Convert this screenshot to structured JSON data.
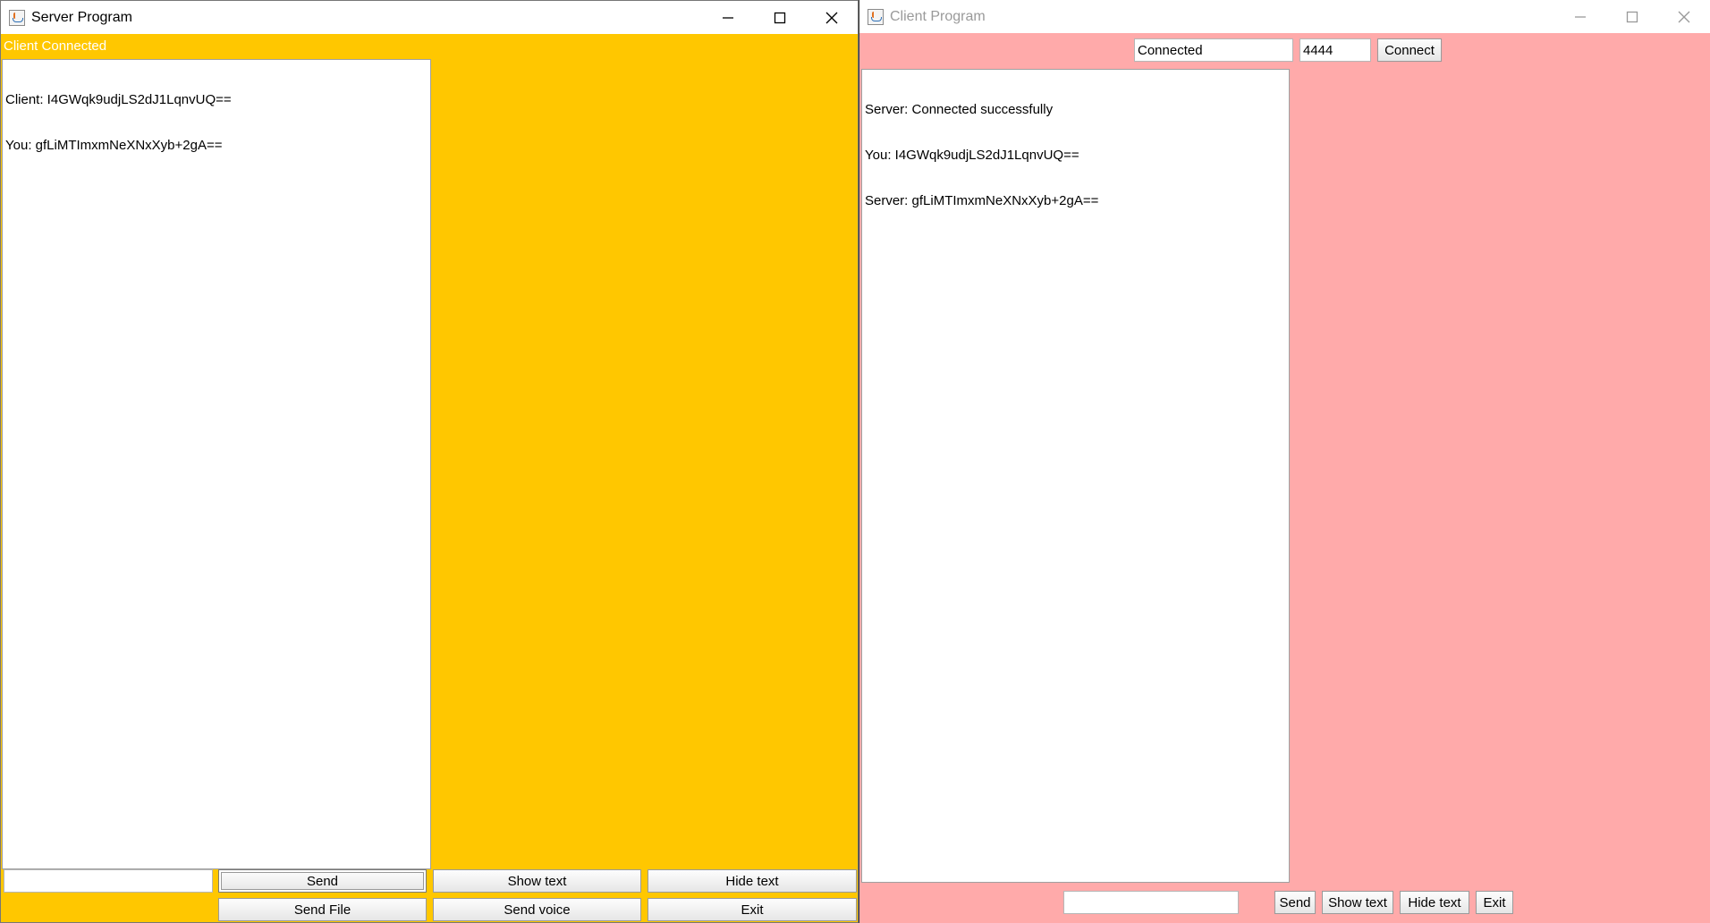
{
  "server": {
    "title": "Server Program",
    "status": "Client Connected",
    "messages": [
      "Client: I4GWqk9udjLS2dJ1LqnvUQ==",
      "You: gfLiMTImxmNeXNxXyb+2gA=="
    ],
    "input_value": "",
    "buttons": {
      "send": "Send",
      "show_text": "Show text",
      "hide_text": "Hide text",
      "send_file": "Send File",
      "send_voice": "Send voice",
      "exit": "Exit"
    }
  },
  "client": {
    "title": "Client Program",
    "host_value": "Connected",
    "port_value": "4444",
    "connect_label": "Connect",
    "messages": [
      "Server: Connected successfully",
      "You: I4GWqk9udjLS2dJ1LqnvUQ==",
      "Server: gfLiMTImxmNeXNxXyb+2gA=="
    ],
    "input_value": "",
    "buttons": {
      "send": "Send",
      "show_text": "Show text",
      "hide_text": "Hide text",
      "exit": "Exit"
    }
  },
  "colors": {
    "server_bg": "#ffc700",
    "client_bg": "#ffaaaa"
  },
  "icons": [
    "java-app-icon",
    "minimize-icon",
    "maximize-icon",
    "close-icon"
  ]
}
